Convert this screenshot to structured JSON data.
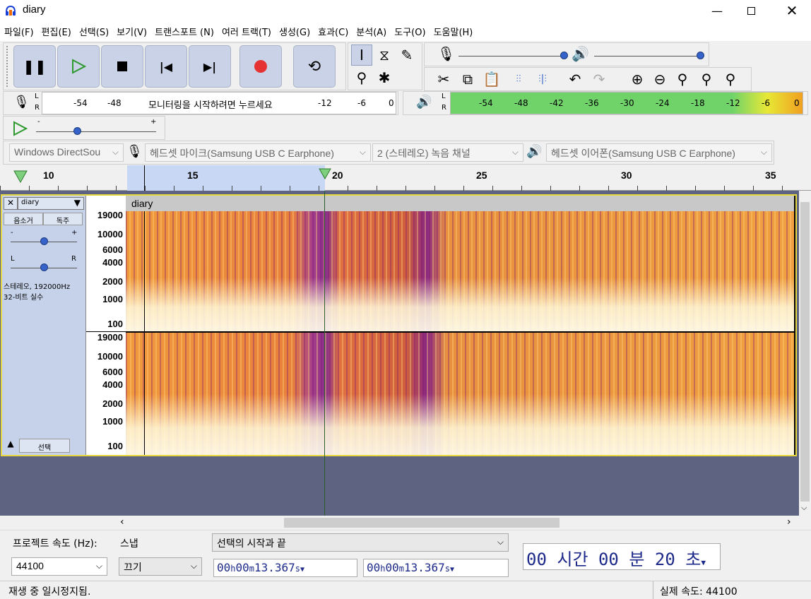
{
  "window": {
    "title": "diary"
  },
  "menu": [
    "파일(F)",
    "편집(E)",
    "선택(S)",
    "보기(V)",
    "트랜스포트 (N)",
    "여러 트랙(T)",
    "생성(G)",
    "효과(C)",
    "분석(A)",
    "도구(O)",
    "도움말(H)"
  ],
  "meters": {
    "record_ticks": [
      "-54",
      "-48",
      "-12",
      "-6",
      "0"
    ],
    "record_prompt": "모니터링을 시작하려면 누르세요",
    "play_ticks": [
      "-54",
      "-48",
      "-42",
      "-36",
      "-30",
      "-24",
      "-18",
      "-12",
      "-6",
      "0"
    ],
    "lr": [
      "L",
      "R"
    ]
  },
  "device": {
    "host": "Windows DirectSou",
    "input": "헤드셋 마이크(Samsung USB C Earphone)",
    "channels": "2 (스테레오) 녹음 채널",
    "output": "헤드셋 이어폰(Samsung USB C Earphone)"
  },
  "ruler": {
    "labels": [
      "10",
      "15",
      "20",
      "25",
      "30",
      "35"
    ]
  },
  "track": {
    "name": "diary",
    "title": "diary",
    "mute": "음소거",
    "solo": "독주",
    "gain_minus": "-",
    "gain_plus": "+",
    "pan_l": "L",
    "pan_r": "R",
    "info1": "스테레오, 192000Hz",
    "info2": "32-비트 실수",
    "select": "선택",
    "freq_labels": [
      "19000",
      "10000",
      "6000",
      "4000",
      "2000",
      "1000",
      "100"
    ]
  },
  "bottom": {
    "rate_label": "프로젝트 속도 (Hz):",
    "snap_label": "스냅",
    "rate_value": "44100",
    "snap_value": "끄기",
    "sel_mode": "선택의 시작과 끝",
    "sel_start": [
      "00",
      "h",
      "00",
      "m",
      "13.367",
      "s"
    ],
    "sel_end": [
      "00",
      "h",
      "00",
      "m",
      "13.367",
      "s"
    ],
    "time": [
      "00",
      "시간",
      "00",
      "분",
      "20",
      "초"
    ]
  },
  "status": {
    "left": "재생 중 일시정지됨.",
    "right": "실제 속도: 44100"
  },
  "colors": {
    "accent": "#3563c9",
    "track_border": "#e8d840",
    "meter_green": "#6fd36a"
  }
}
